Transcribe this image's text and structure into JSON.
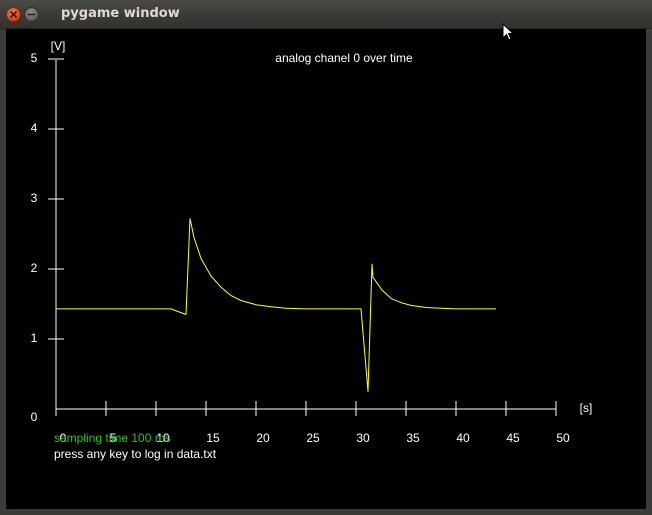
{
  "window": {
    "title": "pygame window",
    "close_icon": "close-icon",
    "minimize_icon": "minimize-icon"
  },
  "colors": {
    "plot_line": "#ffff33",
    "axis": "#ffffff",
    "background": "#000000",
    "status_green": "#22c422"
  },
  "chart_data": {
    "type": "line",
    "title": "analog chanel 0 over time",
    "xlabel": "[s]",
    "ylabel": "[V]",
    "xlim": [
      0,
      50
    ],
    "ylim": [
      0,
      5
    ],
    "x_ticks": [
      "0",
      "5",
      "10",
      "15",
      "20",
      "25",
      "30",
      "35",
      "40",
      "45",
      "50"
    ],
    "y_ticks": [
      "0",
      "1",
      "2",
      "3",
      "4",
      "5"
    ],
    "grid": false,
    "series": [
      {
        "x": [
          0,
          5,
          10,
          11.5,
          13.0,
          13.4,
          13.8,
          14.5,
          15.5,
          16.5,
          17.5,
          18.5,
          20,
          21.5,
          23,
          25,
          28,
          30.5,
          31.2,
          31.6,
          31.7,
          32.0,
          32.6,
          33.5,
          34.5,
          35.5,
          37,
          38.5,
          40,
          42,
          44
        ],
        "y": [
          1.43,
          1.43,
          1.43,
          1.43,
          1.35,
          2.72,
          2.45,
          2.15,
          1.9,
          1.74,
          1.62,
          1.55,
          1.49,
          1.46,
          1.44,
          1.43,
          1.43,
          1.43,
          0.25,
          2.07,
          1.88,
          1.82,
          1.7,
          1.58,
          1.52,
          1.48,
          1.45,
          1.44,
          1.43,
          1.43,
          1.43
        ]
      }
    ]
  },
  "status": {
    "sampling": "sampling time 100 ms",
    "hint": "press any key to log in data.txt"
  }
}
